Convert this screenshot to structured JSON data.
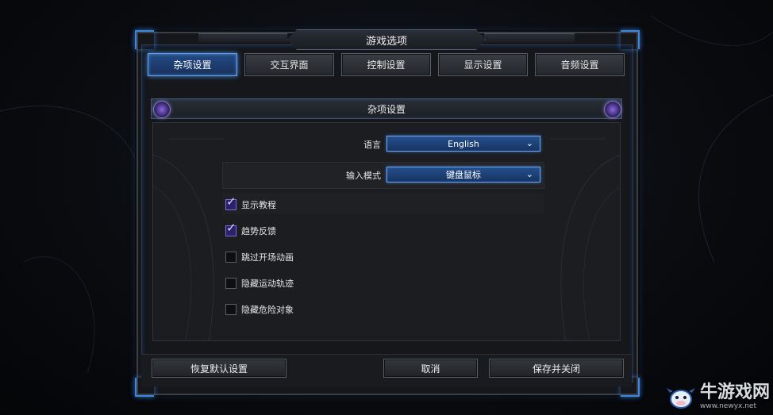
{
  "window": {
    "title": "游戏选项"
  },
  "tabs": [
    {
      "label": "杂项设置",
      "active": true
    },
    {
      "label": "交互界面",
      "active": false
    },
    {
      "label": "控制设置",
      "active": false
    },
    {
      "label": "显示设置",
      "active": false
    },
    {
      "label": "音频设置",
      "active": false
    }
  ],
  "section": {
    "title": "杂项设置"
  },
  "settings": {
    "language": {
      "label": "语言",
      "value": "English"
    },
    "input_mode": {
      "label": "输入模式",
      "value": "键盘鼠标"
    }
  },
  "checkboxes": [
    {
      "label": "显示教程",
      "checked": true
    },
    {
      "label": "趋势反馈",
      "checked": true
    },
    {
      "label": "跳过开场动画",
      "checked": false
    },
    {
      "label": "隐藏运动轨迹",
      "checked": false
    },
    {
      "label": "隐藏危险对象",
      "checked": false
    }
  ],
  "buttons": {
    "restore_defaults": "恢复默认设置",
    "cancel": "取消",
    "save_close": "保存并关闭"
  },
  "watermark": {
    "title": "牛游戏网",
    "url": "www.newyx.net"
  },
  "colors": {
    "accent_blue": "#5fa3ff",
    "tab_active": "#234a86",
    "checkbox_checked": "#2b2166"
  }
}
